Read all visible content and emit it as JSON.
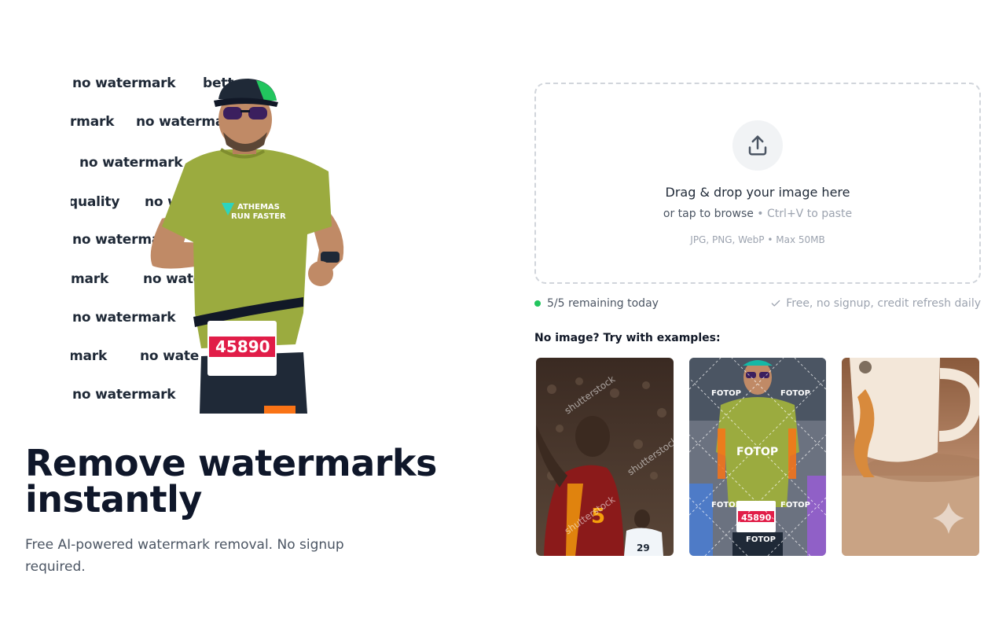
{
  "hero": {
    "watermark_words": [
      "no watermark",
      "bett",
      "rmark",
      "no waterma",
      "no watermark",
      "quality",
      "no w",
      "no waterma",
      "mark",
      "no wate",
      "no watermark",
      "mark",
      "no wate",
      "no watermark"
    ],
    "title": "Remove watermarks instantly",
    "subtitle": "Free AI-powered watermark removal. No signup required.",
    "runner_bib": "45890",
    "runner_shirt": "ATHEMAS RUN FASTER"
  },
  "upload": {
    "icon": "upload-icon",
    "title": "Drag & drop your image here",
    "sub_primary": "or tap to browse",
    "sub_separator": " • ",
    "sub_secondary": "Ctrl+V to paste",
    "formats": "JPG, PNG, WebP • Max 50MB"
  },
  "status": {
    "remaining": "5/5 remaining today",
    "info": "Free, no signup, credit refresh daily",
    "dot_color": "#22c55e"
  },
  "examples": {
    "title": "No image? Try with examples:",
    "items": [
      {
        "name": "football-player-shutterstock",
        "watermark": "shutterstock"
      },
      {
        "name": "runner-fotop",
        "watermark": "FOTOP",
        "bib": "45890"
      },
      {
        "name": "cup-ai-sparkle",
        "watermark": ""
      }
    ]
  }
}
